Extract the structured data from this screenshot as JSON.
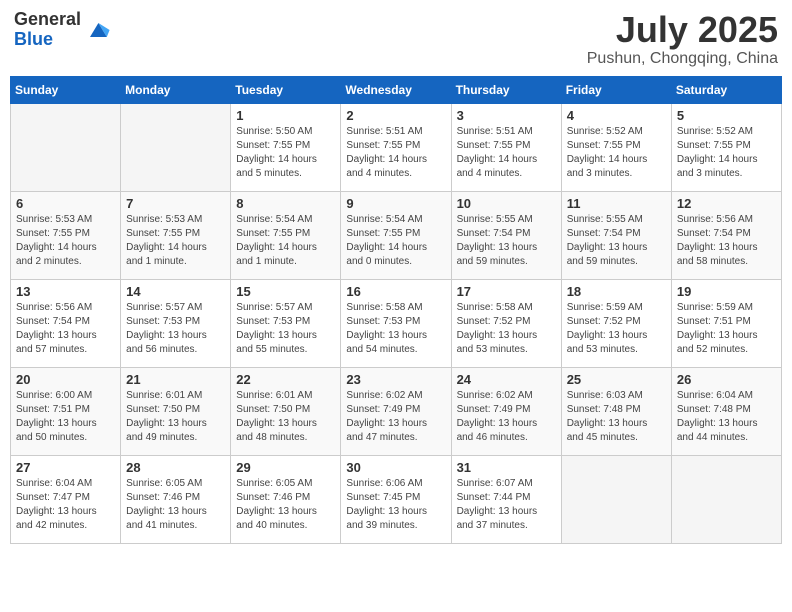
{
  "header": {
    "logo_general": "General",
    "logo_blue": "Blue",
    "month_year": "July 2025",
    "location": "Pushun, Chongqing, China"
  },
  "weekdays": [
    "Sunday",
    "Monday",
    "Tuesday",
    "Wednesday",
    "Thursday",
    "Friday",
    "Saturday"
  ],
  "weeks": [
    [
      {
        "day": "",
        "empty": true
      },
      {
        "day": "",
        "empty": true
      },
      {
        "day": "1",
        "sunrise": "5:50 AM",
        "sunset": "7:55 PM",
        "daylight": "14 hours and 5 minutes."
      },
      {
        "day": "2",
        "sunrise": "5:51 AM",
        "sunset": "7:55 PM",
        "daylight": "14 hours and 4 minutes."
      },
      {
        "day": "3",
        "sunrise": "5:51 AM",
        "sunset": "7:55 PM",
        "daylight": "14 hours and 4 minutes."
      },
      {
        "day": "4",
        "sunrise": "5:52 AM",
        "sunset": "7:55 PM",
        "daylight": "14 hours and 3 minutes."
      },
      {
        "day": "5",
        "sunrise": "5:52 AM",
        "sunset": "7:55 PM",
        "daylight": "14 hours and 3 minutes."
      }
    ],
    [
      {
        "day": "6",
        "sunrise": "5:53 AM",
        "sunset": "7:55 PM",
        "daylight": "14 hours and 2 minutes."
      },
      {
        "day": "7",
        "sunrise": "5:53 AM",
        "sunset": "7:55 PM",
        "daylight": "14 hours and 1 minute."
      },
      {
        "day": "8",
        "sunrise": "5:54 AM",
        "sunset": "7:55 PM",
        "daylight": "14 hours and 1 minute."
      },
      {
        "day": "9",
        "sunrise": "5:54 AM",
        "sunset": "7:55 PM",
        "daylight": "14 hours and 0 minutes."
      },
      {
        "day": "10",
        "sunrise": "5:55 AM",
        "sunset": "7:54 PM",
        "daylight": "13 hours and 59 minutes."
      },
      {
        "day": "11",
        "sunrise": "5:55 AM",
        "sunset": "7:54 PM",
        "daylight": "13 hours and 59 minutes."
      },
      {
        "day": "12",
        "sunrise": "5:56 AM",
        "sunset": "7:54 PM",
        "daylight": "13 hours and 58 minutes."
      }
    ],
    [
      {
        "day": "13",
        "sunrise": "5:56 AM",
        "sunset": "7:54 PM",
        "daylight": "13 hours and 57 minutes."
      },
      {
        "day": "14",
        "sunrise": "5:57 AM",
        "sunset": "7:53 PM",
        "daylight": "13 hours and 56 minutes."
      },
      {
        "day": "15",
        "sunrise": "5:57 AM",
        "sunset": "7:53 PM",
        "daylight": "13 hours and 55 minutes."
      },
      {
        "day": "16",
        "sunrise": "5:58 AM",
        "sunset": "7:53 PM",
        "daylight": "13 hours and 54 minutes."
      },
      {
        "day": "17",
        "sunrise": "5:58 AM",
        "sunset": "7:52 PM",
        "daylight": "13 hours and 53 minutes."
      },
      {
        "day": "18",
        "sunrise": "5:59 AM",
        "sunset": "7:52 PM",
        "daylight": "13 hours and 53 minutes."
      },
      {
        "day": "19",
        "sunrise": "5:59 AM",
        "sunset": "7:51 PM",
        "daylight": "13 hours and 52 minutes."
      }
    ],
    [
      {
        "day": "20",
        "sunrise": "6:00 AM",
        "sunset": "7:51 PM",
        "daylight": "13 hours and 50 minutes."
      },
      {
        "day": "21",
        "sunrise": "6:01 AM",
        "sunset": "7:50 PM",
        "daylight": "13 hours and 49 minutes."
      },
      {
        "day": "22",
        "sunrise": "6:01 AM",
        "sunset": "7:50 PM",
        "daylight": "13 hours and 48 minutes."
      },
      {
        "day": "23",
        "sunrise": "6:02 AM",
        "sunset": "7:49 PM",
        "daylight": "13 hours and 47 minutes."
      },
      {
        "day": "24",
        "sunrise": "6:02 AM",
        "sunset": "7:49 PM",
        "daylight": "13 hours and 46 minutes."
      },
      {
        "day": "25",
        "sunrise": "6:03 AM",
        "sunset": "7:48 PM",
        "daylight": "13 hours and 45 minutes."
      },
      {
        "day": "26",
        "sunrise": "6:04 AM",
        "sunset": "7:48 PM",
        "daylight": "13 hours and 44 minutes."
      }
    ],
    [
      {
        "day": "27",
        "sunrise": "6:04 AM",
        "sunset": "7:47 PM",
        "daylight": "13 hours and 42 minutes."
      },
      {
        "day": "28",
        "sunrise": "6:05 AM",
        "sunset": "7:46 PM",
        "daylight": "13 hours and 41 minutes."
      },
      {
        "day": "29",
        "sunrise": "6:05 AM",
        "sunset": "7:46 PM",
        "daylight": "13 hours and 40 minutes."
      },
      {
        "day": "30",
        "sunrise": "6:06 AM",
        "sunset": "7:45 PM",
        "daylight": "13 hours and 39 minutes."
      },
      {
        "day": "31",
        "sunrise": "6:07 AM",
        "sunset": "7:44 PM",
        "daylight": "13 hours and 37 minutes."
      },
      {
        "day": "",
        "empty": true
      },
      {
        "day": "",
        "empty": true
      }
    ]
  ]
}
